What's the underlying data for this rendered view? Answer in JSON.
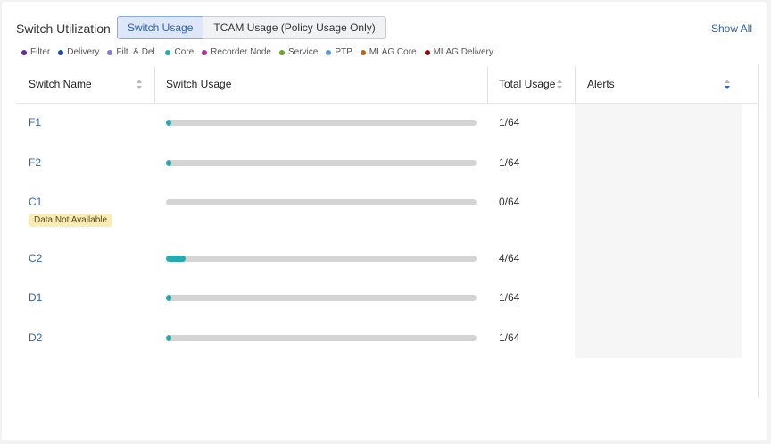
{
  "header": {
    "title": "Switch Utilization",
    "tabs": [
      {
        "label": "Switch Usage",
        "active": true
      },
      {
        "label": "TCAM Usage (Policy Usage Only)",
        "active": false
      }
    ],
    "show_all": "Show All"
  },
  "legend": [
    {
      "label": "Filter",
      "color": "#6a2aa0"
    },
    {
      "label": "Delivery",
      "color": "#1f4fa0"
    },
    {
      "label": "Filt. & Del.",
      "color": "#7b7fd6"
    },
    {
      "label": "Core",
      "color": "#20b2b0"
    },
    {
      "label": "Recorder Node",
      "color": "#b0359c"
    },
    {
      "label": "Service",
      "color": "#6fa32b"
    },
    {
      "label": "PTP",
      "color": "#5b97e0"
    },
    {
      "label": "MLAG Core",
      "color": "#b26a1a"
    },
    {
      "label": "MLAG Delivery",
      "color": "#8b0d0d"
    }
  ],
  "table": {
    "columns": {
      "name": "Switch Name",
      "usage": "Switch Usage",
      "total": "Total Usage",
      "alerts": "Alerts"
    },
    "rows": [
      {
        "name": "F1",
        "total": "1/64",
        "used": 1,
        "capacity": 64,
        "badge": ""
      },
      {
        "name": "F2",
        "total": "1/64",
        "used": 1,
        "capacity": 64,
        "badge": ""
      },
      {
        "name": "C1",
        "total": "0/64",
        "used": 0,
        "capacity": 64,
        "badge": "Data Not Available"
      },
      {
        "name": "C2",
        "total": "4/64",
        "used": 4,
        "capacity": 64,
        "badge": ""
      },
      {
        "name": "D1",
        "total": "1/64",
        "used": 1,
        "capacity": 64,
        "badge": ""
      },
      {
        "name": "D2",
        "total": "1/64",
        "used": 1,
        "capacity": 64,
        "badge": ""
      }
    ]
  }
}
